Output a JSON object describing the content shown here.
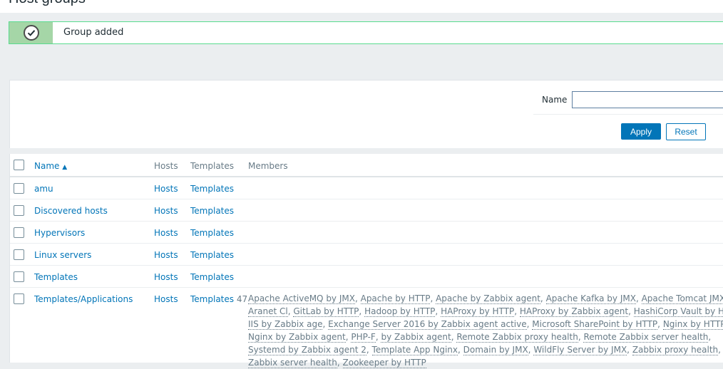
{
  "page": {
    "title": "Host groups"
  },
  "message": {
    "text": "Group added",
    "status_color": "#59db8f"
  },
  "filter": {
    "name_label": "Name",
    "name_value": "",
    "apply_label": "Apply",
    "reset_label": "Reset"
  },
  "table": {
    "headers": {
      "name": "Name",
      "sort_indicator": "▲",
      "hosts": "Hosts",
      "templates": "Templates",
      "members": "Members"
    },
    "rows": [
      {
        "name": "amu",
        "hosts": "Hosts",
        "templates": "Templates"
      },
      {
        "name": "Discovered hosts",
        "hosts": "Hosts",
        "templates": "Templates"
      },
      {
        "name": "Hypervisors",
        "hosts": "Hosts",
        "templates": "Templates"
      },
      {
        "name": "Linux servers",
        "hosts": "Hosts",
        "templates": "Templates"
      },
      {
        "name": "Templates",
        "hosts": "Hosts",
        "templates": "Templates"
      },
      {
        "name": "Templates/Applications",
        "hosts": "Hosts",
        "templates": "Templates",
        "templates_count": "47",
        "members": [
          "Apache ActiveMQ by JMX",
          "Apache by HTTP",
          "Apache by Zabbix agent",
          "Apache Kafka by JMX",
          "Apache Tomcat JMX",
          "Aranet Cl",
          "GitLab by HTTP",
          "Hadoop by HTTP",
          "HAProxy by HTTP",
          "HAProxy by Zabbix agent",
          "HashiCorp Vault by HTTP",
          "IIS by Zabbix age",
          "Exchange Server 2016 by Zabbix agent active",
          "Microsoft SharePoint by HTTP",
          "Nginx by HTTP",
          "Nginx by Zabbix agent",
          "PHP-F",
          "by Zabbix agent",
          "Remote Zabbix proxy health",
          "Remote Zabbix server health",
          "Systemd by Zabbix agent 2",
          "Template App Nginx",
          "Domain by JMX",
          "WildFly Server by JMX",
          "Zabbix proxy health",
          "Zabbix server health",
          "Zookeeper by HTTP"
        ]
      }
    ]
  },
  "colors": {
    "accent": "#0275b8",
    "success": "#59db8f",
    "muted": "#687b87"
  },
  "icons": {
    "message": "check-circle-icon",
    "sort": "sort-asc-icon"
  }
}
